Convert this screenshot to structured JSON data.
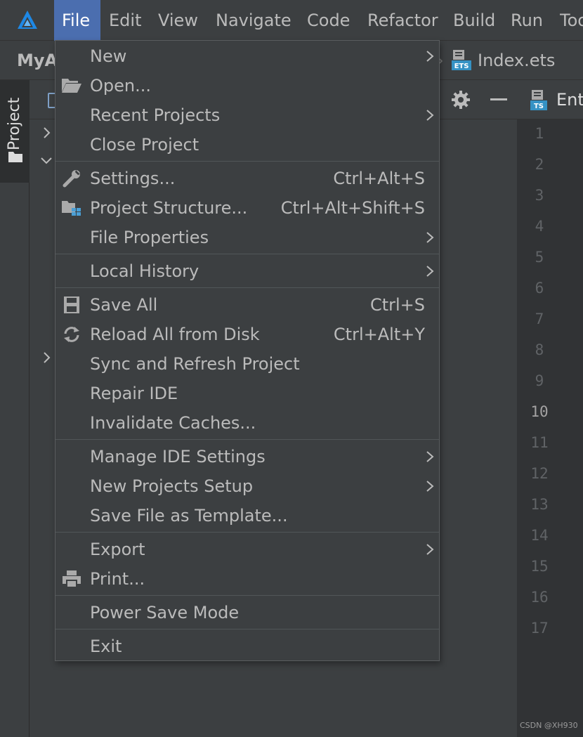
{
  "menubar": {
    "items": [
      {
        "label": "File",
        "active": true
      },
      {
        "label": "Edit"
      },
      {
        "label": "View"
      },
      {
        "label": "Navigate"
      },
      {
        "label": "Code"
      },
      {
        "label": "Refactor"
      },
      {
        "label": "Build"
      },
      {
        "label": "Run"
      },
      {
        "label": "Too"
      }
    ]
  },
  "navbar": {
    "project": "MyA",
    "separator": "›",
    "file": "Index.ets",
    "file_icon_text": "ETS"
  },
  "toolstrip": {
    "project_tab": "Project"
  },
  "editor": {
    "tab_label": "Ent",
    "tab_icon_text": "TS",
    "line_numbers": [
      "1",
      "2",
      "3",
      "4",
      "5",
      "6",
      "7",
      "8",
      "9",
      "10",
      "11",
      "12",
      "13",
      "14",
      "15",
      "16",
      "17"
    ],
    "current_line": "10"
  },
  "watermark": "CSDN @XH930",
  "file_menu": {
    "new": "New",
    "open": "Open...",
    "recent_projects": "Recent Projects",
    "close_project": "Close Project",
    "settings": "Settings...",
    "settings_shortcut": "Ctrl+Alt+S",
    "project_structure": "Project Structure...",
    "project_structure_shortcut": "Ctrl+Alt+Shift+S",
    "file_properties": "File Properties",
    "local_history": "Local History",
    "save_all": "Save All",
    "save_all_shortcut": "Ctrl+S",
    "reload_all": "Reload All from Disk",
    "reload_all_shortcut": "Ctrl+Alt+Y",
    "sync_refresh": "Sync and Refresh Project",
    "repair_ide": "Repair IDE",
    "invalidate_caches": "Invalidate Caches...",
    "manage_ide_settings": "Manage IDE Settings",
    "new_projects_setup": "New Projects Setup",
    "save_as_template": "Save File as Template...",
    "export": "Export",
    "print": "Print...",
    "power_save": "Power Save Mode",
    "exit": "Exit"
  },
  "colors": {
    "menu_bg": "#3c3f41",
    "active_menu": "#4b6eaf",
    "editor_bg": "#2b2b2b",
    "text": "#bbbbbb"
  }
}
